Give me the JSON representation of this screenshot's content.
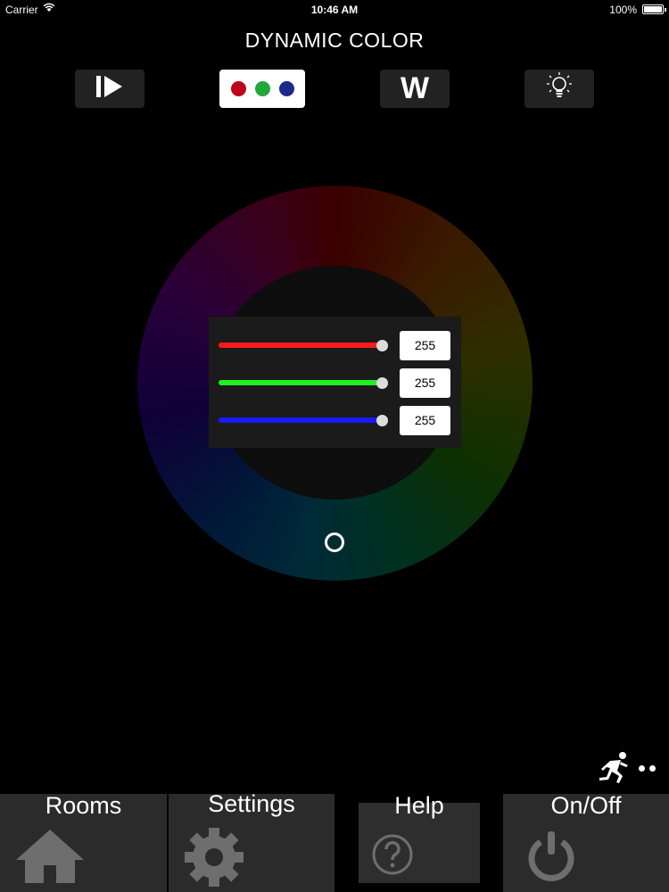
{
  "status_bar": {
    "carrier": "Carrier",
    "time": "10:46 AM",
    "battery": "100%"
  },
  "title": "DYNAMIC COLOR",
  "modes": [
    {
      "name": "play",
      "icon": "play-icon"
    },
    {
      "name": "rgb",
      "icon": "rgb-dots-icon",
      "selected": true,
      "dot_colors": [
        "#c0001a",
        "#22a83a",
        "#1c2a8a"
      ]
    },
    {
      "name": "white",
      "label": "W"
    },
    {
      "name": "bulb",
      "icon": "lightbulb-icon"
    }
  ],
  "rgb": {
    "red": {
      "value": "255",
      "color": "#ff1a1a"
    },
    "green": {
      "value": "255",
      "color": "#22ee22"
    },
    "blue": {
      "value": "255",
      "color": "#1a1aff"
    }
  },
  "nav": {
    "rooms": "Rooms",
    "settings": "Settings",
    "help": "Help",
    "onoff": "On/Off"
  }
}
